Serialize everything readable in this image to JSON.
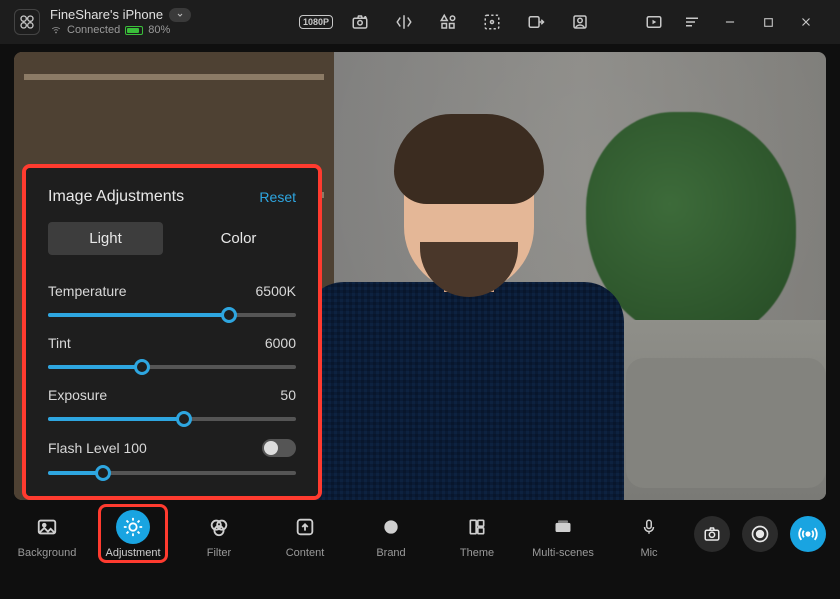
{
  "topbar": {
    "device_name": "FineShare's iPhone",
    "status_text": "Connected",
    "battery_text": "80%",
    "resolution_label": "1080P"
  },
  "panel": {
    "title": "Image Adjustments",
    "reset_label": "Reset",
    "tabs": {
      "light": "Light",
      "color": "Color",
      "active": "light"
    },
    "controls": {
      "temperature": {
        "label": "Temperature",
        "value_text": "6500K",
        "percent": 73
      },
      "tint": {
        "label": "Tint",
        "value_text": "6000",
        "percent": 38
      },
      "exposure": {
        "label": "Exposure",
        "value_text": "50",
        "percent": 55
      },
      "flash": {
        "label": "Flash Level 100",
        "enabled": false,
        "percent": 22
      }
    }
  },
  "nav": {
    "items": [
      {
        "key": "background",
        "label": "Background"
      },
      {
        "key": "adjustment",
        "label": "Adjustment"
      },
      {
        "key": "filter",
        "label": "Filter"
      },
      {
        "key": "content",
        "label": "Content"
      },
      {
        "key": "brand",
        "label": "Brand"
      },
      {
        "key": "theme",
        "label": "Theme"
      },
      {
        "key": "multiscenes",
        "label": "Multi-scenes"
      },
      {
        "key": "mic",
        "label": "Mic"
      }
    ],
    "active_key": "adjustment"
  },
  "colors": {
    "accent": "#19a4e1",
    "highlight": "#ff3b2f"
  }
}
